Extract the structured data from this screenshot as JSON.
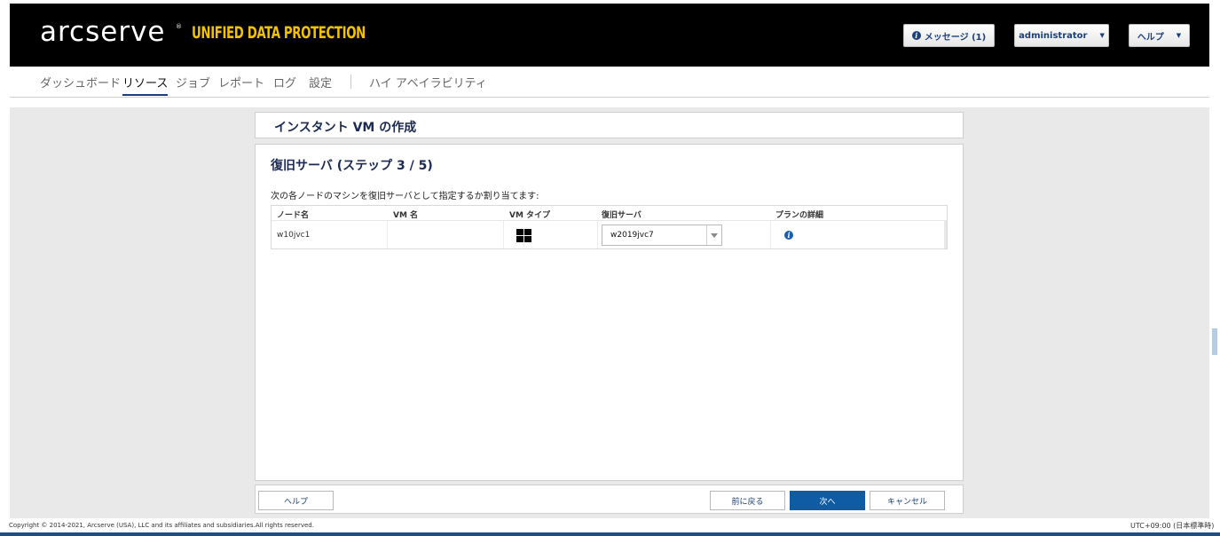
{
  "header": {
    "logo": "arcserve",
    "logo_reg": "®",
    "product": "UNIFIED DATA PROTECTION",
    "messages_label": "メッセージ (1)",
    "user_label": "administrator",
    "help_label": "ヘルプ"
  },
  "nav": {
    "items": [
      "ダッシュボード",
      "リソース",
      "ジョブ",
      "レポート",
      "ログ",
      "設定",
      "ハイ アベイラビリティ"
    ],
    "active": "リソース"
  },
  "page": {
    "title": "インスタント VM の作成",
    "step_title": "復旧サーバ (ステップ 3 / 5)",
    "instruction": "次の各ノードのマシンを復旧サーバとして指定するか割り当てます:"
  },
  "table": {
    "columns": [
      "ノード名",
      "VM 名",
      "VM タイプ",
      "復旧サーバ",
      "プランの詳細"
    ],
    "rows": [
      {
        "node": "w10jvc1",
        "vm_name": "",
        "vm_type_icon": "windows-icon",
        "recovery_server": "w2019jvc7",
        "plan_icon": "info-icon"
      }
    ]
  },
  "footer": {
    "help": "ヘルプ",
    "back": "前に戻る",
    "next": "次へ",
    "cancel": "キャンセル"
  },
  "status": {
    "copyright": "Copyright © 2014-2021, Arcserve (USA), LLC and its affiliates and subsidiaries.All rights reserved.",
    "timezone": "UTC+09:00 (日本標準時)"
  },
  "colors": {
    "header_bg": "#000000",
    "product_accent": "#f2c200",
    "primary_button": "#0f5ba4",
    "title_text": "#1b2a55"
  }
}
